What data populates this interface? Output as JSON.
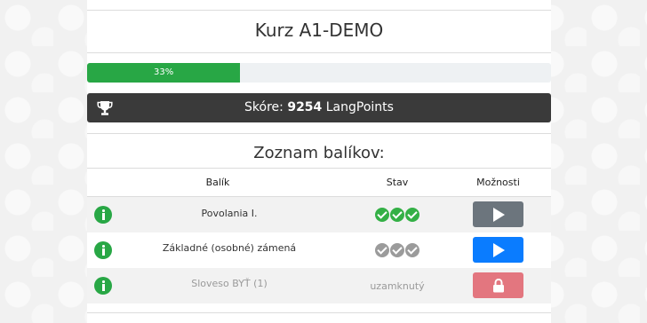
{
  "course": {
    "title": "Kurz A1-DEMO",
    "progress_label": "33%",
    "progress_value": 0.33
  },
  "score": {
    "label": "Skóre:",
    "value": "9254",
    "unit": "LangPoints",
    "icon": "trophy-icon"
  },
  "packages": {
    "title": "Zoznam balíkov:",
    "headers": {
      "package": "Balík",
      "status": "Stav",
      "options": "Možnosti"
    },
    "rows": [
      {
        "name": "Povolania I.",
        "status": "completed",
        "checks": 3,
        "action": "play",
        "action_color": "#6c757d"
      },
      {
        "name": "Základné (osobné) zámená",
        "status": "in-progress",
        "checks": 3,
        "action": "play",
        "action_color": "#0a7cff"
      },
      {
        "name": "Sloveso BYŤ (1)",
        "status_text": "uzamknutý",
        "action": "locked",
        "action_color": "#e3767f"
      }
    ]
  },
  "colors": {
    "progress": "#28a745",
    "score_bar": "#3a3a3a",
    "info": "#28a745",
    "check_done": "#34b046",
    "check_pending": "#9b9b9b"
  }
}
